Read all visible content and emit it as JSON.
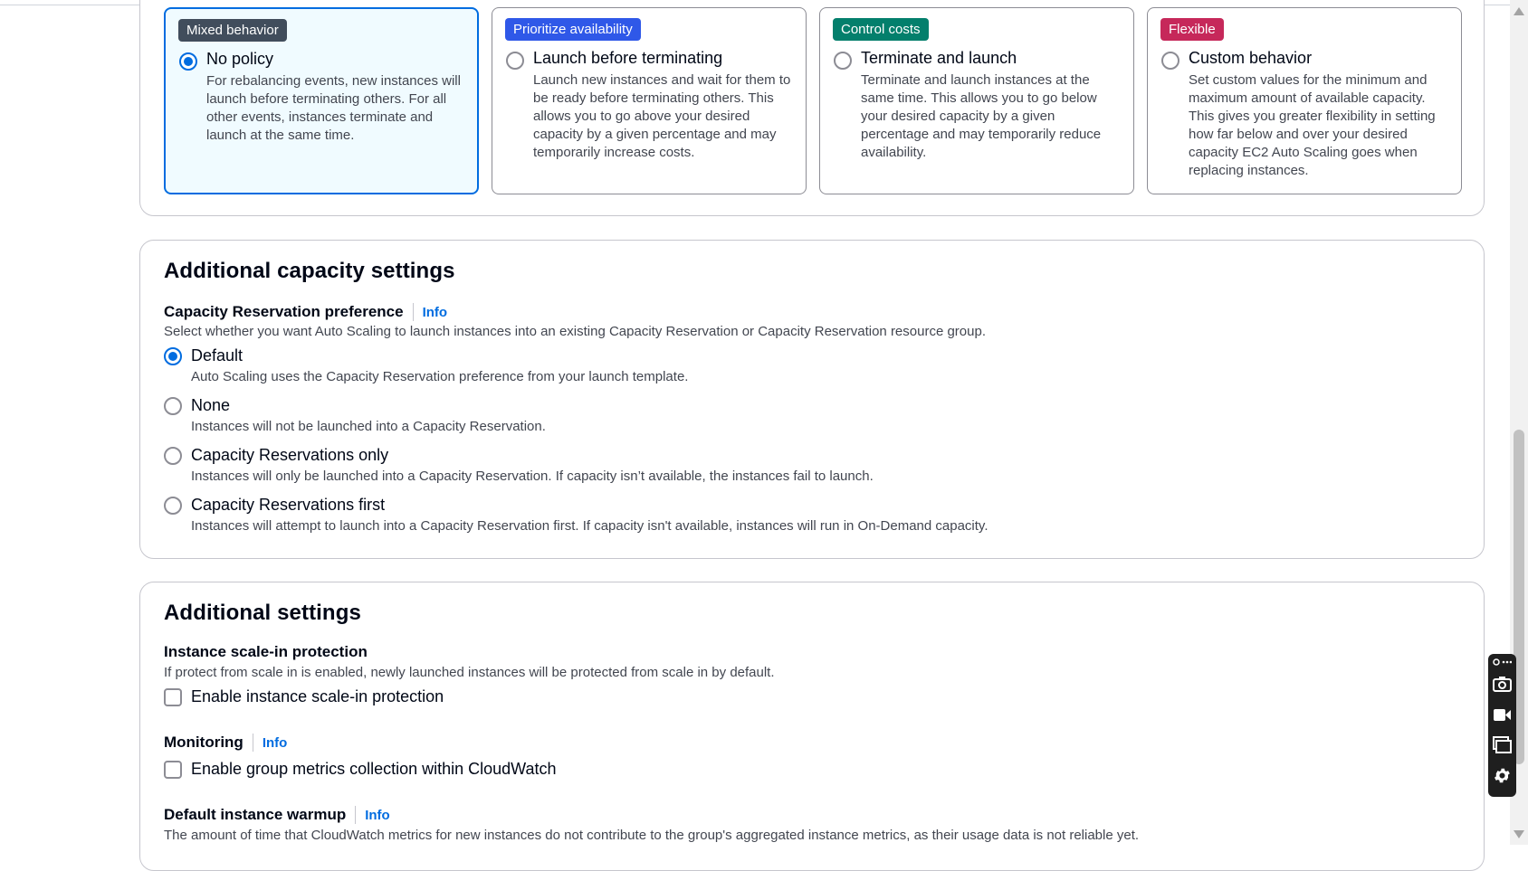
{
  "strategy": {
    "tiles": [
      {
        "badge": "Mixed behavior",
        "badge_color": "#414d5c",
        "title": "No policy",
        "selected": true,
        "description": "For rebalancing events, new instances will launch before terminating others. For all other events, instances terminate and launch at the same time."
      },
      {
        "badge": "Prioritize availability",
        "badge_color": "#2f58e8",
        "title": "Launch before terminating",
        "selected": false,
        "description": "Launch new instances and wait for them to be ready before terminating others. This allows you to go above your desired capacity by a given percentage and may temporarily increase costs."
      },
      {
        "badge": "Control costs",
        "badge_color": "#037f6c",
        "title": "Terminate and launch",
        "selected": false,
        "description": "Terminate and launch instances at the same time. This allows you to go below your desired capacity by a given percentage and may temporarily reduce availability."
      },
      {
        "badge": "Flexible",
        "badge_color": "#c6285a",
        "title": "Custom behavior",
        "selected": false,
        "description": "Set custom values for the minimum and maximum amount of available capacity. This gives you greater flexibility in setting how far below and over your desired capacity EC2 Auto Scaling goes when replacing instances."
      }
    ]
  },
  "capacity": {
    "heading": "Additional capacity settings",
    "reservation_label": "Capacity Reservation preference",
    "info": "Info",
    "reservation_desc": "Select whether you want Auto Scaling to launch instances into an existing Capacity Reservation or Capacity Reservation resource group.",
    "options": [
      {
        "title": "Default",
        "desc": "Auto Scaling uses the Capacity Reservation preference from your launch template.",
        "selected": true
      },
      {
        "title": "None",
        "desc": "Instances will not be launched into a Capacity Reservation.",
        "selected": false
      },
      {
        "title": "Capacity Reservations only",
        "desc": "Instances will only be launched into a Capacity Reservation. If capacity isn’t available, the instances fail to launch.",
        "selected": false
      },
      {
        "title": "Capacity Reservations first",
        "desc": "Instances will attempt to launch into a Capacity Reservation first. If capacity isn't available, instances will run in On-Demand capacity.",
        "selected": false
      }
    ]
  },
  "additional": {
    "heading": "Additional settings",
    "scalein_label": "Instance scale-in protection",
    "scalein_desc": "If protect from scale in is enabled, newly launched instances will be protected from scale in by default.",
    "scalein_checkbox": "Enable instance scale-in protection",
    "monitoring_label": "Monitoring",
    "monitoring_info": "Info",
    "monitoring_checkbox": "Enable group metrics collection within CloudWatch",
    "warmup_label": "Default instance warmup",
    "warmup_info": "Info",
    "warmup_desc": "The amount of time that CloudWatch metrics for new instances do not contribute to the group's aggregated instance metrics, as their usage data is not reliable yet."
  },
  "colors": {
    "accent": "#006ce0",
    "text_secondary": "#424650"
  }
}
